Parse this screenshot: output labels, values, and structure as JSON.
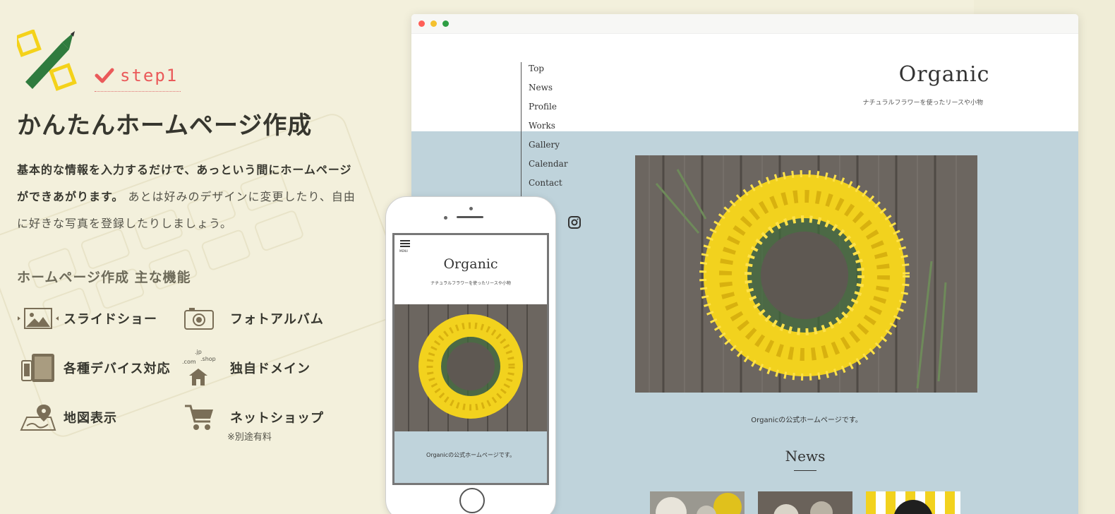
{
  "step": {
    "label": "step1"
  },
  "main": {
    "title": "かんたんホームページ作成",
    "desc_strong": "基本的な情報を入力するだけで、あっという間にホームページができあがります。",
    "desc_rest": " あとは好みのデザインに変更したり、自由に好きな写真を登録したりしましょう。",
    "features_title": "ホームページ作成 主な機能",
    "features": [
      {
        "label": "スライドショー",
        "icon": "slideshow-icon"
      },
      {
        "label": "フォトアルバム",
        "icon": "camera-icon"
      },
      {
        "label": "各種デバイス対応",
        "icon": "devices-icon"
      },
      {
        "label": "独自ドメイン",
        "icon": "domain-house-icon"
      },
      {
        "label": "地図表示",
        "icon": "map-pin-icon"
      },
      {
        "label": "ネットショップ",
        "icon": "cart-icon"
      }
    ],
    "note": "※別途有料",
    "domain_labels": {
      "jp": ".jp",
      "com": ".com",
      "shop": ".shop"
    }
  },
  "site": {
    "title": "Organic",
    "subtitle": "ナチュラルフラワーを使ったリースや小物",
    "nav": [
      "Top",
      "News",
      "Profile",
      "Works",
      "Gallery",
      "Calendar",
      "Contact"
    ],
    "hero_caption": "Organicの公式ホームページです。",
    "news_title": "News",
    "instagram_icon": "instagram-icon"
  },
  "phone": {
    "title": "Organic",
    "subtitle": "ナチュラルフラワーを使ったリースや小物",
    "menu_label": "MENU",
    "caption": "Organicの公式ホームページです。"
  },
  "colors": {
    "background": "#f3f0dc",
    "accent_red": "#ea5a5a",
    "site_blue": "#bfd3db",
    "icon_brown": "#7a6e57",
    "logo_green": "#2f7b3e",
    "logo_yellow": "#f4d21a"
  }
}
